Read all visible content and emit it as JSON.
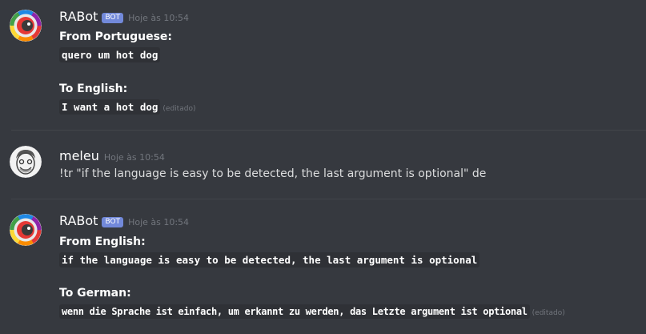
{
  "messages": [
    {
      "author": "RABot",
      "bot_tag": "BOT",
      "timestamp": "Hoje às 10:54",
      "from_label": "From Portuguese:",
      "from_text": "quero um hot dog",
      "to_label": "To English:",
      "to_text": "I want a hot dog",
      "edited": "(editado)"
    },
    {
      "author": "meleu",
      "timestamp": "Hoje às 10:54",
      "text": "!tr \"if the language is easy to be detected, the last argument is optional\" de"
    },
    {
      "author": "RABot",
      "bot_tag": "BOT",
      "timestamp": "Hoje às 10:54",
      "from_label": "From English:",
      "from_text": "if the language is easy to be detected, the last argument is optional",
      "to_label": "To German:",
      "to_text": "wenn die Sprache ist einfach, um erkannt zu werden, das Letzte argument ist optional",
      "edited": "(editado)"
    }
  ],
  "colors": {
    "background": "#36393f",
    "bot_tag": "#7289da",
    "timestamp": "#72767d",
    "code_bg": "#2f3136"
  }
}
